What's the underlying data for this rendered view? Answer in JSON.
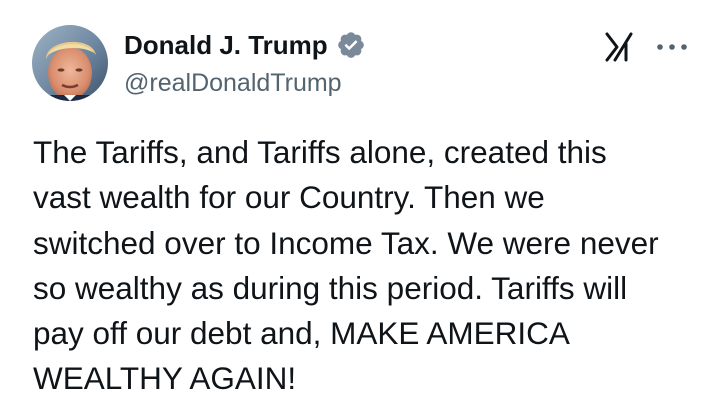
{
  "author": {
    "display_name": "Donald J. Trump",
    "handle": "@realDonaldTrump",
    "verified": true,
    "verified_badge_color": "#7a8a9a",
    "avatar_icon": "profile-photo"
  },
  "actions": {
    "grok_icon": "grok-icon",
    "more_icon": "more-dots-icon"
  },
  "post": {
    "text": "The Tariffs, and Tariffs alone, created this\nvast wealth for our Country. Then we\nswitched over to Income Tax. We were never\nso wealthy as during this period. Tariffs will\npay off our debt and, MAKE AMERICA\nWEALTHY AGAIN!"
  },
  "colors": {
    "text_primary": "#0f1419",
    "text_secondary": "#536471",
    "background": "#ffffff"
  }
}
